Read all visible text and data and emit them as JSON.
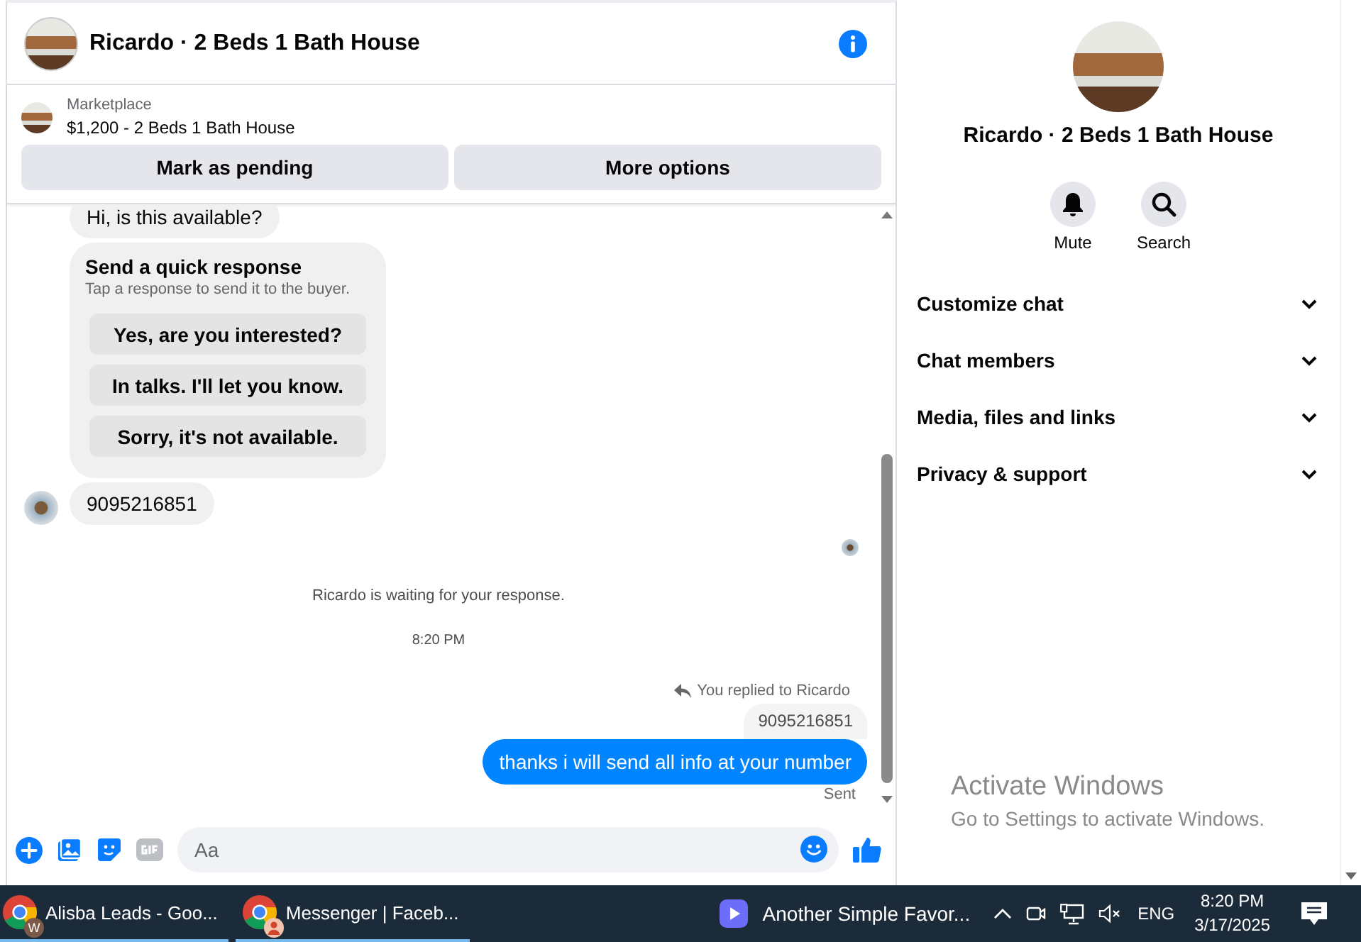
{
  "chat_header": {
    "title": "Ricardo · 2 Beds 1 Bath House"
  },
  "listing": {
    "source": "Marketplace",
    "title": "$1,200 - 2 Beds 1 Bath House",
    "buttons": [
      "Mark as pending",
      "More options"
    ]
  },
  "messages": [
    {
      "kind": "incoming",
      "text": "Hi, is this available?",
      "avatar": false
    },
    {
      "kind": "quick_response",
      "title": "Send a quick response",
      "subtitle": "Tap a response to send it to the buyer.",
      "options": [
        "Yes, are you interested?",
        "In talks. I'll let you know.",
        "Sorry, it's not available."
      ]
    },
    {
      "kind": "incoming",
      "text": "9095216851",
      "avatar": true
    },
    {
      "kind": "seen"
    },
    {
      "kind": "notice",
      "text": "Ricardo is waiting for your response."
    },
    {
      "kind": "timestamp",
      "text": "8:20 PM"
    },
    {
      "kind": "reply",
      "label": "You replied to Ricardo",
      "quoted": "9095216851",
      "text": "thanks i will send all info at your number",
      "status": "Sent"
    }
  ],
  "composer": {
    "placeholder": "Aa"
  },
  "info_panel": {
    "title": "Ricardo · 2 Beds 1 Bath House",
    "actions": [
      "Mute",
      "Search"
    ],
    "sections": [
      {
        "label": "Customize chat",
        "expanded": false
      },
      {
        "label": "Chat members",
        "expanded": false
      },
      {
        "label": "Media, files and links",
        "expanded": false
      },
      {
        "label": "Privacy & support",
        "expanded": false
      }
    ]
  },
  "activation_notice": {
    "title": "Activate Windows",
    "subtitle": "Go to Settings to activate Windows."
  },
  "taskbar": {
    "apps": [
      {
        "label": "Alisba Leads - Goo...",
        "badge": "W"
      },
      {
        "label": "Messenger | Faceb..."
      }
    ],
    "media": "Another Simple Favor...",
    "language": "ENG",
    "time": "8:20 PM",
    "date": "3/17/2025"
  }
}
